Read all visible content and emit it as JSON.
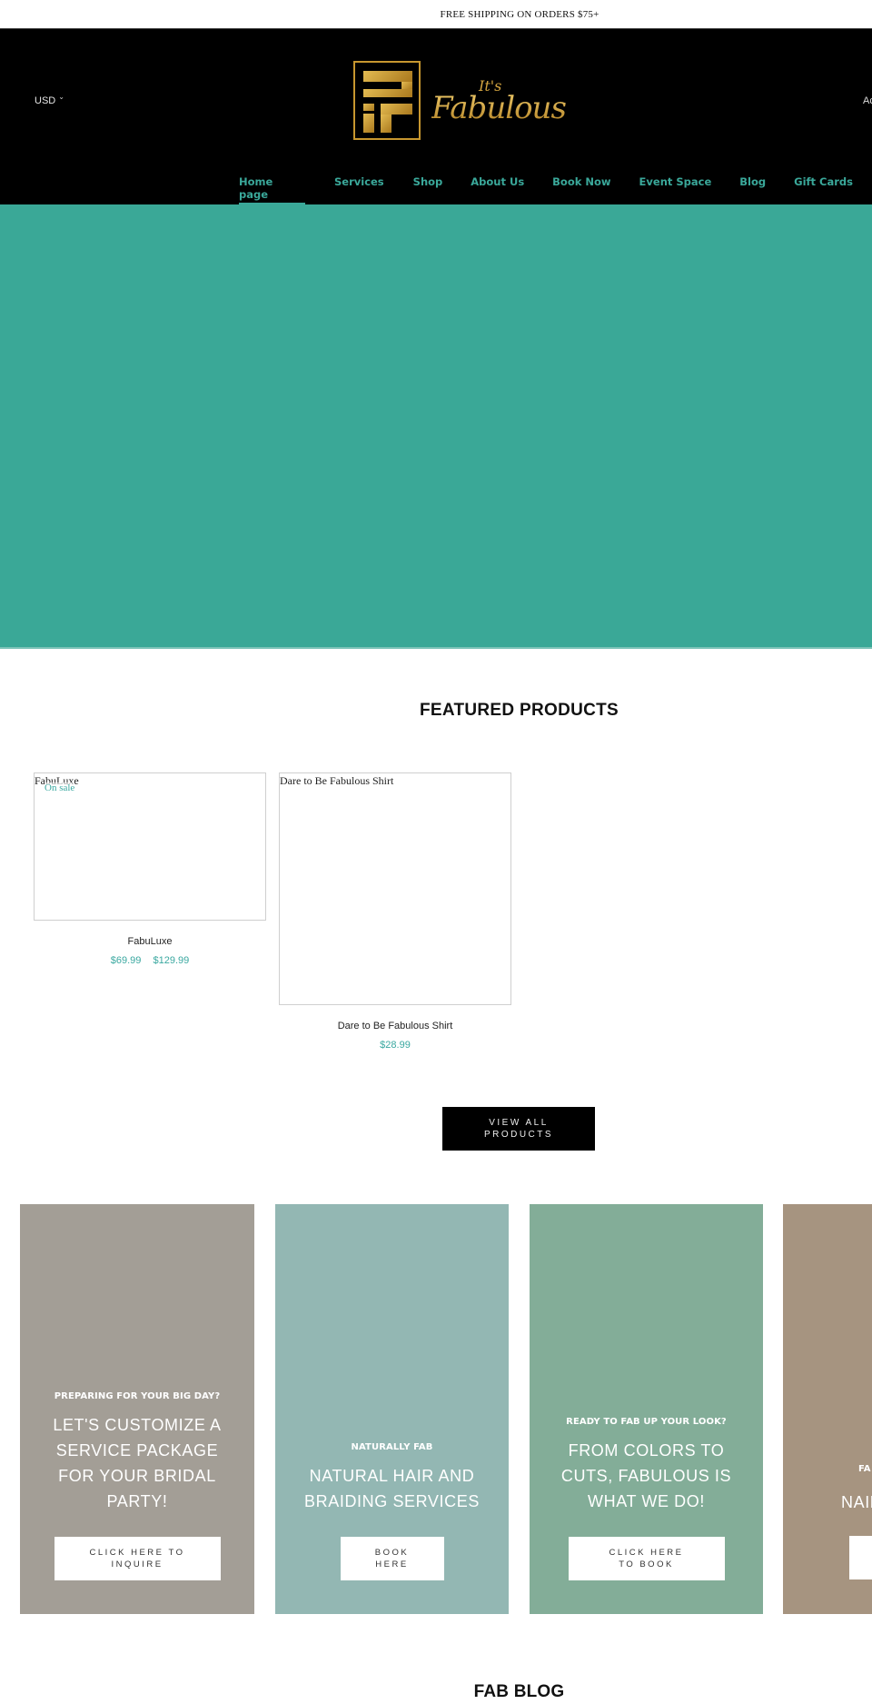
{
  "announcement": "FREE SHIPPING ON ORDERS $75+",
  "header": {
    "currency": "USD",
    "currency_icon": "chevron-down-icon",
    "account_label": "Account",
    "logo": {
      "its": "It's",
      "name": "Fabulous",
      "mark": "iF"
    },
    "colors": {
      "background": "#000000",
      "gold": "#c7972f",
      "nav": "#3aa89a"
    }
  },
  "nav": {
    "items": [
      {
        "label": "Home page",
        "active": true
      },
      {
        "label": "Services",
        "active": false
      },
      {
        "label": "Shop",
        "active": false
      },
      {
        "label": "About Us",
        "active": false
      },
      {
        "label": "Book Now",
        "active": false
      },
      {
        "label": "Event Space",
        "active": false
      },
      {
        "label": "Blog",
        "active": false
      },
      {
        "label": "Gift Cards",
        "active": false
      }
    ]
  },
  "hero": {
    "color": "#3aa897"
  },
  "featured": {
    "title": "FEATURED PRODUCTS",
    "products": [
      {
        "image_alt": "FabuLuxe",
        "badge": "On sale",
        "name": "FabuLuxe",
        "price_sale": "$69.99",
        "price_regular": "$129.99"
      },
      {
        "image_alt": "Dare to Be Fabulous Shirt",
        "name": "Dare to Be Fabulous Shirt",
        "price": "$28.99"
      }
    ],
    "view_all_label": "VIEW ALL PRODUCTS"
  },
  "promos": [
    {
      "eyebrow": "PREPARING FOR YOUR BIG DAY?",
      "headline": "LET'S CUSTOMIZE A SERVICE PACKAGE FOR YOUR BRIDAL PARTY!",
      "button": "CLICK HERE TO INQUIRE",
      "color": "#a39e96"
    },
    {
      "eyebrow": "NATURALLY FAB",
      "headline": "NATURAL HAIR AND BRAIDING SERVICES",
      "button": "BOOK HERE",
      "color": "#93b7b3"
    },
    {
      "eyebrow": "READY TO FAB UP YOUR LOOK?",
      "headline": "FROM COLORS TO CUTS, FABULOUS IS WHAT WE DO!",
      "button": "CLICK HERE TO BOOK",
      "color": "#83ad98"
    },
    {
      "eyebrow": "FA",
      "headline": "NAIL",
      "button": "",
      "color": "#a69480"
    }
  ],
  "blog": {
    "title": "FAB BLOG"
  }
}
